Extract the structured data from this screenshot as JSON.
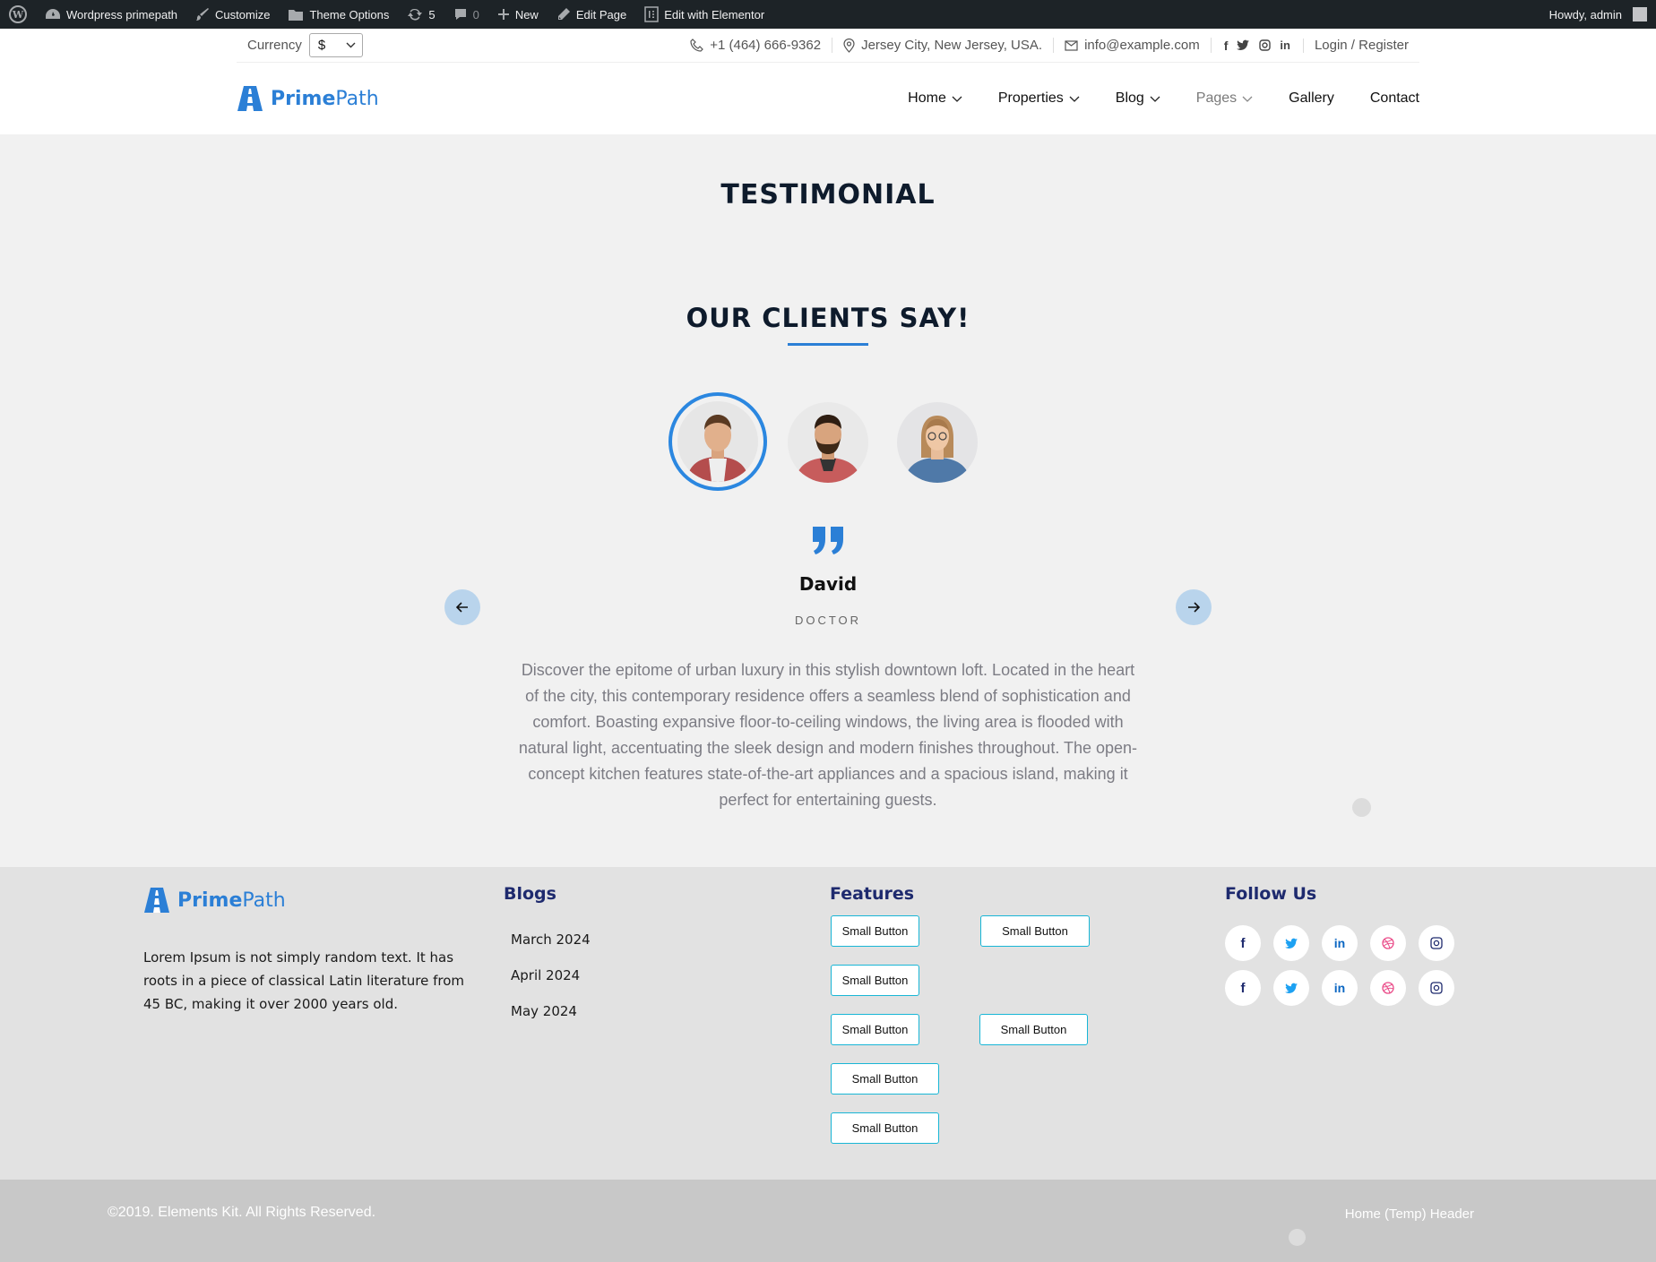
{
  "admin_bar": {
    "site_name": "Wordpress primepath",
    "customize": "Customize",
    "theme_options": "Theme Options",
    "updates_count": "5",
    "comments_count": "0",
    "new": "New",
    "edit_page": "Edit Page",
    "edit_elementor": "Edit with Elementor",
    "howdy": "Howdy, admin"
  },
  "topbar": {
    "currency_label": "Currency",
    "currency_value": "$",
    "phone": "+1 (464) 666-9362",
    "address": "Jersey City, New Jersey, USA.",
    "email": "info@example.com",
    "login": "Login / Register"
  },
  "header": {
    "logo_prime": "Prime",
    "logo_path": "Path",
    "nav": [
      {
        "label": "Home",
        "has_dropdown": true
      },
      {
        "label": "Properties",
        "has_dropdown": true
      },
      {
        "label": "Blog",
        "has_dropdown": true
      },
      {
        "label": "Pages",
        "has_dropdown": true
      },
      {
        "label": "Gallery",
        "has_dropdown": false
      },
      {
        "label": "Contact",
        "has_dropdown": false
      }
    ]
  },
  "page": {
    "title": "TESTIMONIAL",
    "section_title": "OUR CLIENTS SAY!"
  },
  "testimonial": {
    "name": "David",
    "role": "DOCTOR",
    "text": "Discover the epitome of urban luxury in this stylish downtown loft. Located in the heart of the city, this contemporary residence offers a seamless blend of sophistication and comfort. Boasting expansive floor-to-ceiling windows, the living area is flooded with natural light, accentuating the sleek design and modern finishes throughout. The open-concept kitchen features state-of-the-art appliances and a spacious island, making it perfect for entertaining guests."
  },
  "footer": {
    "about": "Lorem Ipsum is not simply random text. It has roots in a piece of classical Latin literature from 45 BC, making it over 2000 years old.",
    "blogs_heading": "Blogs",
    "blogs": [
      "March 2024",
      "April 2024",
      "May 2024"
    ],
    "features_heading": "Features",
    "button_label": "Small Button",
    "follow_heading": "Follow Us",
    "copyright": "©2019. Elements Kit. All Rights Reserved.",
    "home_header": "Home (Temp) Header"
  },
  "colors": {
    "accent": "#2b7fd6",
    "footer_heading": "#1e2a6e",
    "button_border": "#18b6d6"
  }
}
